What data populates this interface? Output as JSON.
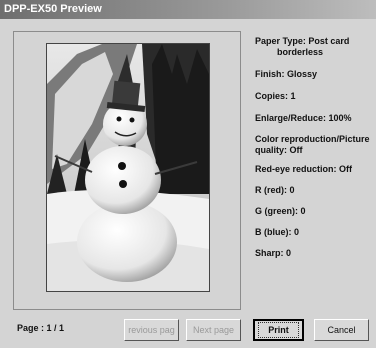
{
  "window": {
    "title": "DPP-EX50 Preview"
  },
  "photo": {
    "subject": "snowman"
  },
  "settings": {
    "paper_type_label": "Paper Type: Post card",
    "paper_type_value2": "borderless",
    "finish": "Finish: Glossy",
    "copies": "Copies: 1",
    "enlarge": "Enlarge/Reduce: 100%",
    "color_repro_line1": "Color reproduction/Picture",
    "color_repro_line2": "quality: Off",
    "redeye": "Red-eye reduction: Off",
    "r": "R (red): 0",
    "g": "G (green): 0",
    "b": "B (blue): 0",
    "sharp": "Sharp: 0"
  },
  "footer": {
    "page": "Page : 1 / 1",
    "previous_label": "revious pag",
    "next_label": "Next page",
    "print_label": "Print",
    "cancel_label": "Cancel"
  }
}
